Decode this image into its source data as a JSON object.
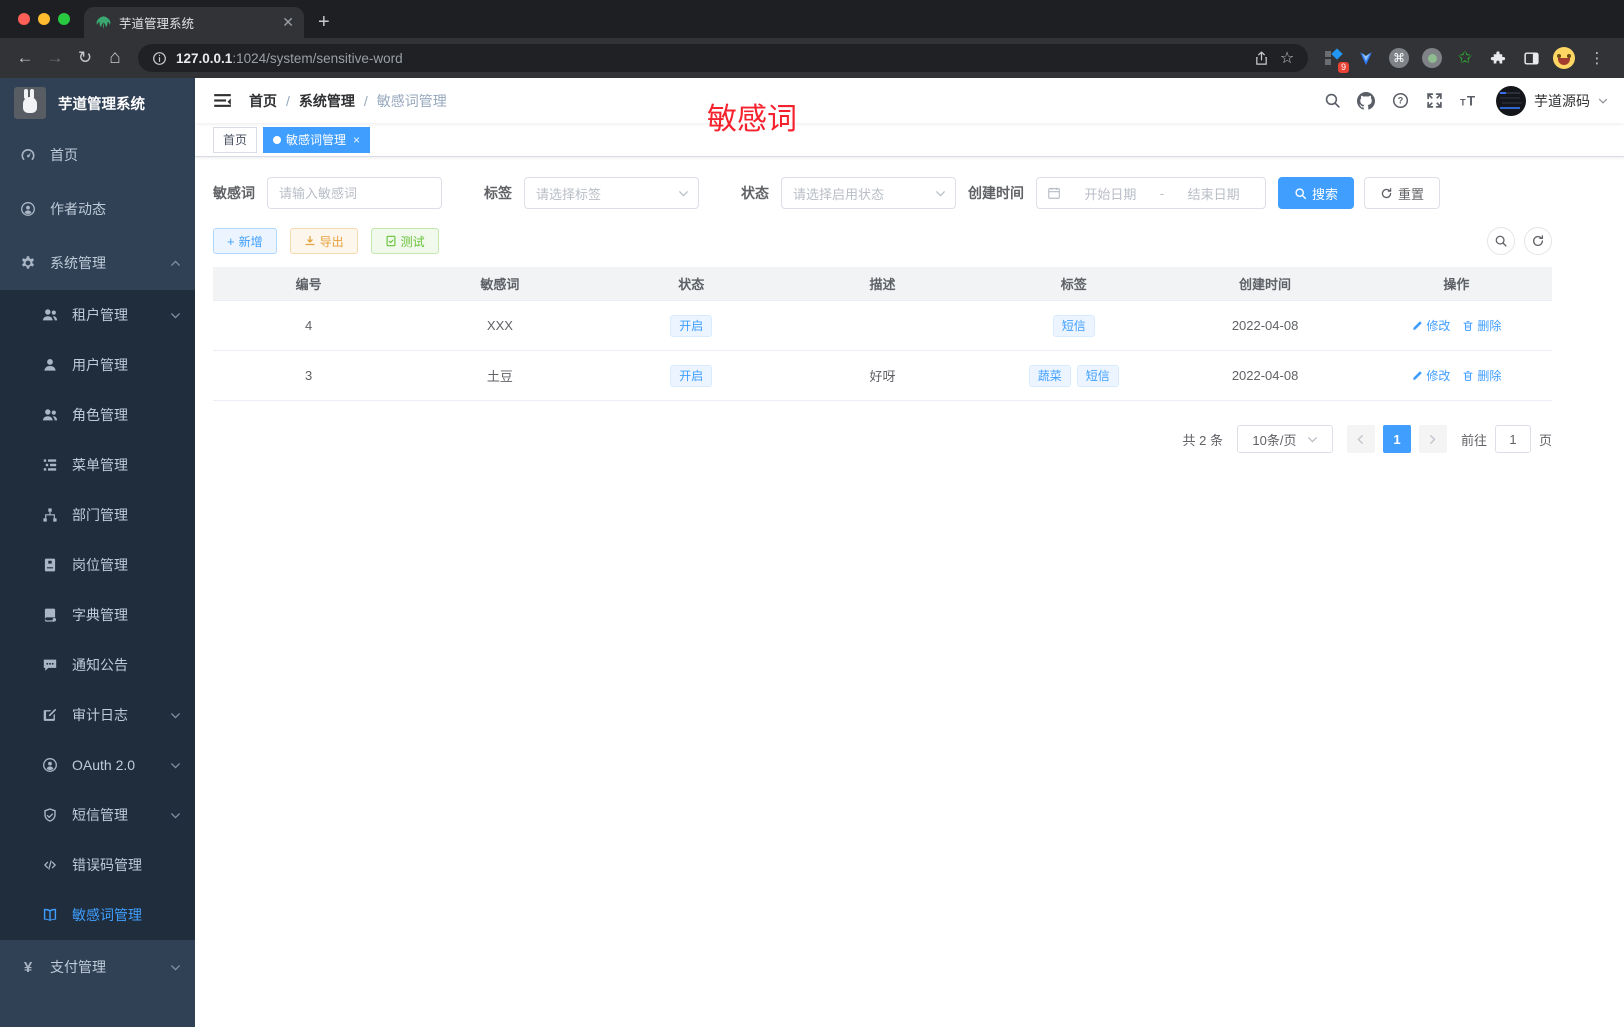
{
  "colors": {
    "accent": "#409eff",
    "overlay_red": "#f5222d",
    "warning": "#e6a23c",
    "success": "#67c23a",
    "sidebar_bg": "#304156",
    "sidebar_sub_bg": "#1f2d3d"
  },
  "browser": {
    "tab_title": "芋道管理系统",
    "url_host": "127.0.0.1",
    "url_rest": ":1024/system/sensitive-word",
    "extension_badge": "9"
  },
  "sidebar": {
    "logo_title": "芋道管理系统",
    "items": [
      {
        "label": "首页",
        "icon": "dashboard-icon",
        "level": 0
      },
      {
        "label": "作者动态",
        "icon": "author-icon",
        "level": 0
      },
      {
        "label": "系统管理",
        "icon": "gear-icon",
        "level": 0,
        "chevron": "up"
      },
      {
        "label": "租户管理",
        "icon": "users-icon",
        "level": 1,
        "chevron": "down"
      },
      {
        "label": "用户管理",
        "icon": "user-icon",
        "level": 1
      },
      {
        "label": "角色管理",
        "icon": "users-icon",
        "level": 1
      },
      {
        "label": "菜单管理",
        "icon": "menu-tree-icon",
        "level": 1
      },
      {
        "label": "部门管理",
        "icon": "org-icon",
        "level": 1
      },
      {
        "label": "岗位管理",
        "icon": "badge-icon",
        "level": 1
      },
      {
        "label": "字典管理",
        "icon": "dict-icon",
        "level": 1
      },
      {
        "label": "通知公告",
        "icon": "notice-icon",
        "level": 1
      },
      {
        "label": "审计日志",
        "icon": "log-icon",
        "level": 1,
        "chevron": "down"
      },
      {
        "label": "OAuth 2.0",
        "icon": "oauth-icon",
        "level": 1,
        "chevron": "down"
      },
      {
        "label": "短信管理",
        "icon": "shield-icon",
        "level": 1,
        "chevron": "down"
      },
      {
        "label": "错误码管理",
        "icon": "code-icon",
        "level": 1
      },
      {
        "label": "敏感词管理",
        "icon": "open-book-icon",
        "level": 1,
        "active": true
      },
      {
        "label": "支付管理",
        "icon": "yen-icon",
        "level": 0,
        "chevron": "down"
      }
    ]
  },
  "header": {
    "breadcrumb": [
      "首页",
      "系统管理",
      "敏感词管理"
    ],
    "overlay_text": "敏感词",
    "username": "芋道源码"
  },
  "tags": [
    {
      "label": "首页",
      "active": false
    },
    {
      "label": "敏感词管理",
      "active": true
    }
  ],
  "filters": {
    "keyword_label": "敏感词",
    "keyword_placeholder": "请输入敏感词",
    "tag_label": "标签",
    "tag_placeholder": "请选择标签",
    "status_label": "状态",
    "status_placeholder": "请选择启用状态",
    "date_label": "创建时间",
    "date_start_placeholder": "开始日期",
    "date_separator": "-",
    "date_end_placeholder": "结束日期",
    "search_label": "搜索",
    "reset_label": "重置"
  },
  "toolbar": {
    "add_label": "新增",
    "export_label": "导出",
    "test_label": "测试"
  },
  "table": {
    "headers": [
      "编号",
      "敏感词",
      "状态",
      "描述",
      "标签",
      "创建时间",
      "操作"
    ],
    "edit_label": "修改",
    "delete_label": "删除",
    "rows": [
      {
        "id": "4",
        "word": "XXX",
        "status": "开启",
        "desc": "",
        "tags": [
          "短信"
        ],
        "created": "2022-04-08"
      },
      {
        "id": "3",
        "word": "土豆",
        "status": "开启",
        "desc": "好呀",
        "tags": [
          "蔬菜",
          "短信"
        ],
        "created": "2022-04-08"
      }
    ]
  },
  "pagination": {
    "total_text": "共 2 条",
    "page_size_text": "10条/页",
    "current_page": "1",
    "goto_label": "前往",
    "goto_value": "1",
    "page_unit": "页"
  }
}
